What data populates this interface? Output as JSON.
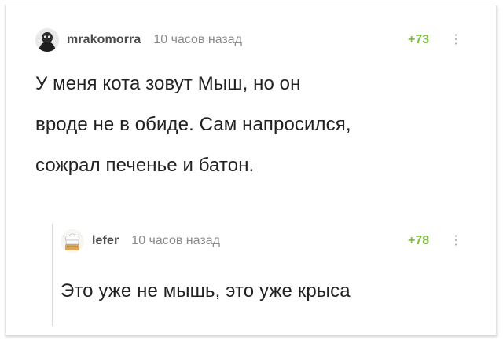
{
  "root_comment": {
    "username": "mrakomorra",
    "timestamp": "10 часов назад",
    "rating": "+73",
    "menu_icon": "vertical-ellipsis-icon",
    "lines": [
      "У меня кота зовут Мыш, но он",
      "вроде не в обиде. Сам напросился,",
      "сожрал печенье и батон."
    ]
  },
  "reply_comment": {
    "username": "lefer",
    "timestamp": "10 часов назад",
    "rating": "+78",
    "menu_icon": "vertical-ellipsis-icon",
    "text": "Это уже не мышь, это уже крыса"
  },
  "colors": {
    "rating_positive": "#7fbe3f",
    "username": "#4a4a4a",
    "timestamp": "#8a8a8a",
    "text": "#222222"
  }
}
